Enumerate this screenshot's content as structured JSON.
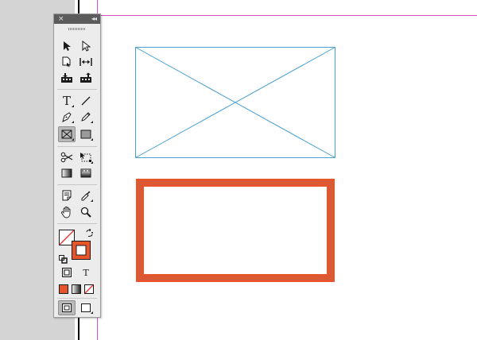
{
  "canvas": {
    "colors": {
      "pasteboard": "#d4d4d4",
      "page": "#ffffff",
      "margin_guide": "#d64fc4",
      "frame_stroke": "#4a9fd4",
      "selected_stroke": "#e8552a"
    }
  },
  "objects": [
    {
      "name": "placeholder-image-frame",
      "type": "empty-graphic-frame"
    },
    {
      "name": "orange-stroke-rectangle",
      "type": "rectangle-frame",
      "stroke_color": "#e8552a",
      "fill": "none"
    }
  ],
  "toolbox": {
    "close_glyph": "×",
    "collapse_glyph": "◂◂",
    "type_tool_label": "T",
    "formatting_text_label": "T",
    "tools": [
      {
        "name": "selection-tool",
        "icon": "black-arrow-icon"
      },
      {
        "name": "direct-selection-tool",
        "icon": "white-arrow-icon"
      },
      {
        "name": "page-tool",
        "icon": "page-icon"
      },
      {
        "name": "gap-tool",
        "icon": "gap-icon"
      },
      {
        "name": "content-collector-tool",
        "icon": "collector-icon"
      },
      {
        "name": "content-placer-tool",
        "icon": "placer-icon"
      },
      {
        "name": "type-tool",
        "icon": "type-icon"
      },
      {
        "name": "line-tool",
        "icon": "line-icon"
      },
      {
        "name": "pen-tool",
        "icon": "pen-icon"
      },
      {
        "name": "pencil-tool",
        "icon": "pencil-icon"
      },
      {
        "name": "rectangle-frame-tool",
        "icon": "rect-frame-icon",
        "active": true
      },
      {
        "name": "rectangle-tool",
        "icon": "rect-icon"
      },
      {
        "name": "scissors-tool",
        "icon": "scissors-icon"
      },
      {
        "name": "free-transform-tool",
        "icon": "transform-icon"
      },
      {
        "name": "gradient-swatch-tool",
        "icon": "gradient-icon"
      },
      {
        "name": "gradient-feather-tool",
        "icon": "feather-icon"
      },
      {
        "name": "note-tool",
        "icon": "note-icon"
      },
      {
        "name": "eyedropper-tool",
        "icon": "eyedropper-icon"
      },
      {
        "name": "hand-tool",
        "icon": "hand-icon"
      },
      {
        "name": "zoom-tool",
        "icon": "magnifier-icon"
      }
    ],
    "fill_stroke": {
      "fill": "none",
      "stroke_color": "#e8552a"
    },
    "apply_buttons": [
      "apply-color",
      "apply-gradient",
      "apply-none"
    ],
    "view_modes": [
      "normal-view",
      "screen-mode"
    ]
  }
}
